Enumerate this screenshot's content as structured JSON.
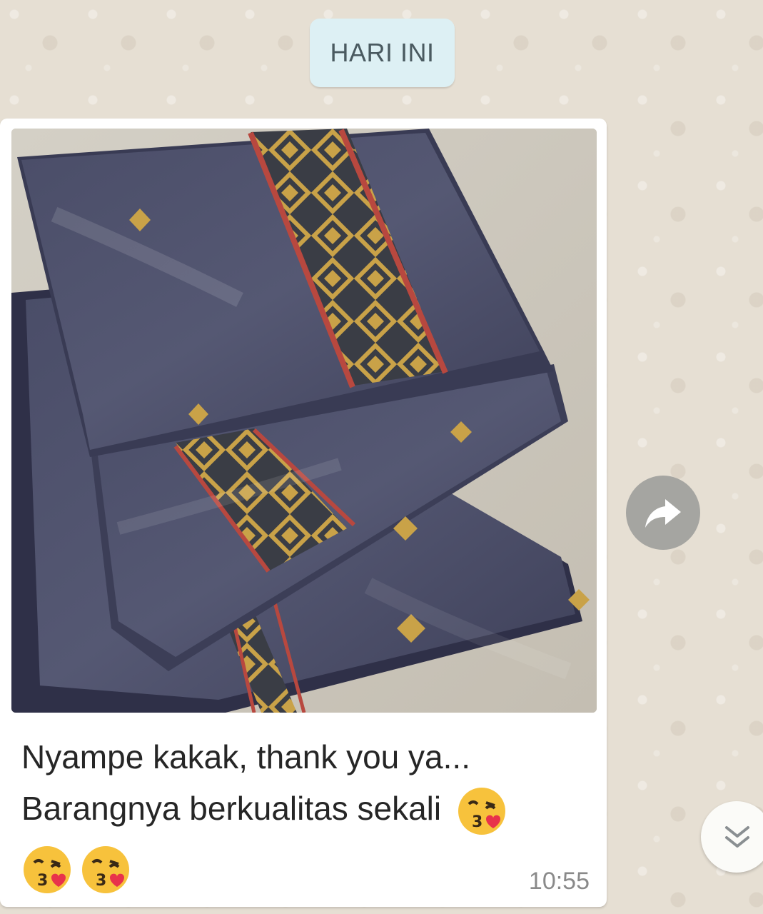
{
  "date_separator": {
    "label": "HARI INI"
  },
  "message": {
    "image": {
      "icon": "shared-photo"
    },
    "caption_line1": "Nyampe kakak, thank you ya...",
    "caption_line2": "Barangnya berkualitas sekali",
    "emoji_icon": "kissing-face-heart-emoji",
    "timestamp": "10:55"
  },
  "forward_button": {
    "icon": "forward-arrow-icon"
  },
  "scroll_button": {
    "icon": "chevron-double-down-icon"
  },
  "colors": {
    "chat_background": "#e6dfd3",
    "bubble": "#ffffff",
    "date_chip": "#ddf0f4",
    "fabric": "#4a4c66",
    "fabric_gold": "#c9a248",
    "fabric_red": "#b8483f"
  }
}
